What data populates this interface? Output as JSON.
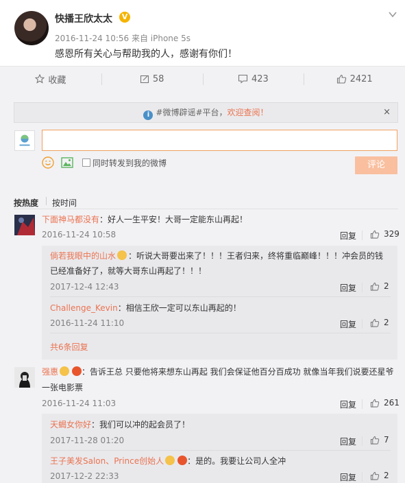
{
  "post": {
    "author": "快播王欣太太",
    "verified_icon": "V",
    "meta": "2016-11-24 10:56 来自 iPhone 5s",
    "text": "感恩所有关心与帮助我的人，感谢有你们！"
  },
  "actions": {
    "favorite": "收藏",
    "repost": "58",
    "comment": "423",
    "like": "2421"
  },
  "notice": {
    "prefix": "#微博辟谣#平台，",
    "highlight": "欢迎查阅！",
    "close": "×"
  },
  "composer": {
    "repost_label": "同时转发到我的微博",
    "submit_label": "评论"
  },
  "sort": {
    "hot": "按热度",
    "time": "按时间"
  },
  "labels": {
    "reply": "回复"
  },
  "comments": [
    {
      "user": "下面神马都没有",
      "text": "：好人一生平安！大哥一定能东山再起！",
      "time": "2016-11-24 10:58",
      "likes": "329",
      "replies": [
        {
          "user": "倘若我眼中的山水",
          "text_line1": "：听说大哥要出来了！！！王者归来，终将重临巅峰！！！冲会员的钱",
          "text_line2": "已经准备好了，就等大哥东山再起了！！！",
          "time": "2017-12-4 12:43",
          "likes": "2"
        },
        {
          "user": "Challenge_Kevin",
          "text": "：相信王欣一定可以东山再起的！",
          "time": "2016-11-24 11:10",
          "likes": "2"
        }
      ],
      "more": "共6条回复"
    },
    {
      "user": "强惠",
      "text_line1": "：告诉王总 只要他将来想东山再起 我们会保证他百分百成功 就像当年我们说要还星爷",
      "text_line2": "一张电影票",
      "time": "2016-11-24 11:03",
      "likes": "261",
      "replies": [
        {
          "user": "天蝎女你好",
          "text": "：我们可以冲的起会员了！",
          "time": "2017-11-28 01:20",
          "likes": "7"
        },
        {
          "user": "王子美发Salon、Prince创始人",
          "text": "：是的。我要让公司人全冲",
          "time": "2017-12-2 22:33",
          "likes": "2"
        }
      ]
    }
  ]
}
